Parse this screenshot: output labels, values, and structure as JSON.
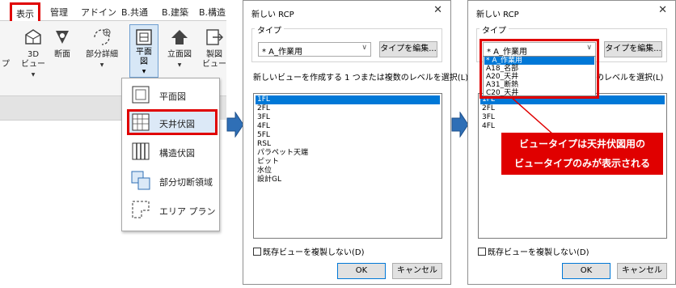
{
  "ribbon": {
    "tabs": [
      "表示",
      "管理",
      "アドイン",
      "B.共通",
      "B.建築",
      "B.構造"
    ],
    "buttons": [
      {
        "label": "3D\nビュー",
        "icon": "3d-view-icon"
      },
      {
        "label": "断面",
        "icon": "section-icon"
      },
      {
        "label": "部分詳細",
        "icon": "callout-icon"
      },
      {
        "label": "平面\n図",
        "icon": "plan-view-icon"
      },
      {
        "label": "立面図",
        "icon": "elevation-icon"
      },
      {
        "label": "製図\nビュー",
        "icon": "drafting-view-icon"
      }
    ],
    "dropdown_items": [
      "平面図",
      "天井伏図",
      "構造伏図",
      "部分切断領域",
      "エリア プラン"
    ],
    "highlight_color": "#e00000"
  },
  "dialog1": {
    "title": "新しい RCP",
    "type_group_label": "タイプ",
    "type_value": "* A_作業用",
    "edit_type_button": "タイプを編集...",
    "prompt": "新しいビューを作成する 1 つまたは複数のレベルを選択(L)",
    "levels": [
      "1FL",
      "2FL",
      "3FL",
      "4FL",
      "5FL",
      "RSL",
      "パラペット天端",
      "ピット",
      "水位",
      "設計GL"
    ],
    "selected_level": "1FL",
    "no_duplicate_label": "既存ビューを複製しない(D)",
    "ok_label": "OK",
    "cancel_label": "キャンセル"
  },
  "dialog2": {
    "title": "新しい RCP",
    "type_group_label": "タイプ",
    "type_value": "* A_作業用",
    "edit_type_button": "タイプを編集...",
    "prompt_visible": "のレベルを選択(L)",
    "type_options": [
      "* A_作業用",
      "A18_名部",
      "A20_天井",
      "A31_断熱",
      "C20_天井"
    ],
    "levels_visible": [
      "1FL",
      "2FL",
      "3FL",
      "4FL"
    ],
    "no_duplicate_label": "既存ビューを複製しない(D)",
    "ok_label": "OK",
    "cancel_label": "キャンセル"
  },
  "callout": {
    "line1": "ビュータイプは天井伏図用の",
    "line2": "ビュータイプのみが表示される"
  },
  "colors": {
    "accent_red": "#e00000",
    "selection_blue": "#0078d7",
    "arrow_blue": "#2f6fb6"
  }
}
